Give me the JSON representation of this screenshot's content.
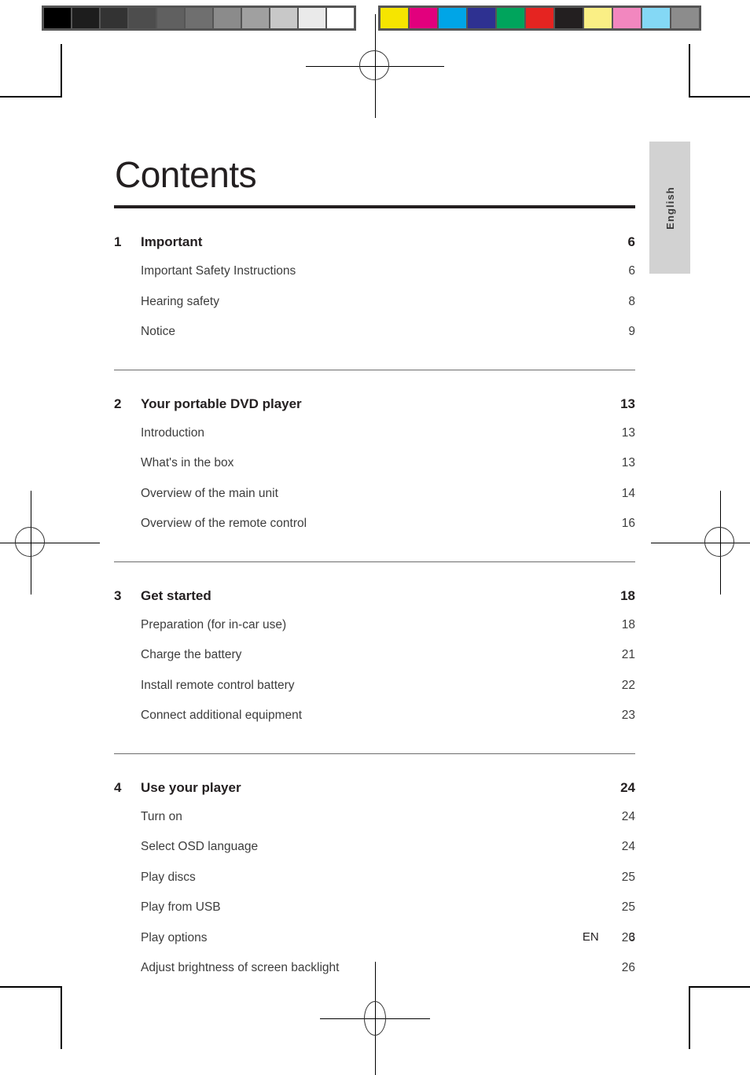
{
  "calibration": {
    "gray_ramp": [
      "#000000",
      "#1d1d1d",
      "#333333",
      "#4d4d4d",
      "#606060",
      "#6f6f6f",
      "#8b8b8b",
      "#a0a0a0",
      "#c8c8c8",
      "#eaeaea",
      "#ffffff"
    ],
    "color_ramp": [
      "#f6e500",
      "#e2007d",
      "#00a5e7",
      "#2e3191",
      "#00a45c",
      "#e52421",
      "#231f20",
      "#faef85",
      "#f287bf",
      "#84d8f5",
      "#8c8c8c"
    ],
    "strip_background": "#555555"
  },
  "page": {
    "title": "Contents",
    "language_tab": "English",
    "footer": {
      "language_code": "EN",
      "page_number": "3"
    }
  },
  "toc": {
    "sections": [
      {
        "number": "1",
        "title": "Important",
        "page": "6",
        "entries": [
          {
            "label": "Important Safety Instructions",
            "page": "6"
          },
          {
            "label": "Hearing safety",
            "page": "8"
          },
          {
            "label": "Notice",
            "page": "9"
          }
        ]
      },
      {
        "number": "2",
        "title": "Your portable DVD player",
        "page": "13",
        "entries": [
          {
            "label": "Introduction",
            "page": "13"
          },
          {
            "label": "What's in the box",
            "page": "13"
          },
          {
            "label": "Overview of the main unit",
            "page": "14"
          },
          {
            "label": "Overview of the remote control",
            "page": "16"
          }
        ]
      },
      {
        "number": "3",
        "title": "Get started",
        "page": "18",
        "entries": [
          {
            "label": "Preparation (for in-car use)",
            "page": "18"
          },
          {
            "label": "Charge the battery",
            "page": "21"
          },
          {
            "label": "Install remote control battery",
            "page": "22"
          },
          {
            "label": "Connect additional equipment",
            "page": "23"
          }
        ]
      },
      {
        "number": "4",
        "title": "Use your player",
        "page": "24",
        "entries": [
          {
            "label": "Turn on",
            "page": "24"
          },
          {
            "label": "Select OSD language",
            "page": "24"
          },
          {
            "label": "Play discs",
            "page": "25"
          },
          {
            "label": "Play from USB",
            "page": "25"
          },
          {
            "label": "Play options",
            "page": "26"
          },
          {
            "label": "Adjust brightness of screen backlight",
            "page": "26"
          }
        ]
      }
    ]
  }
}
